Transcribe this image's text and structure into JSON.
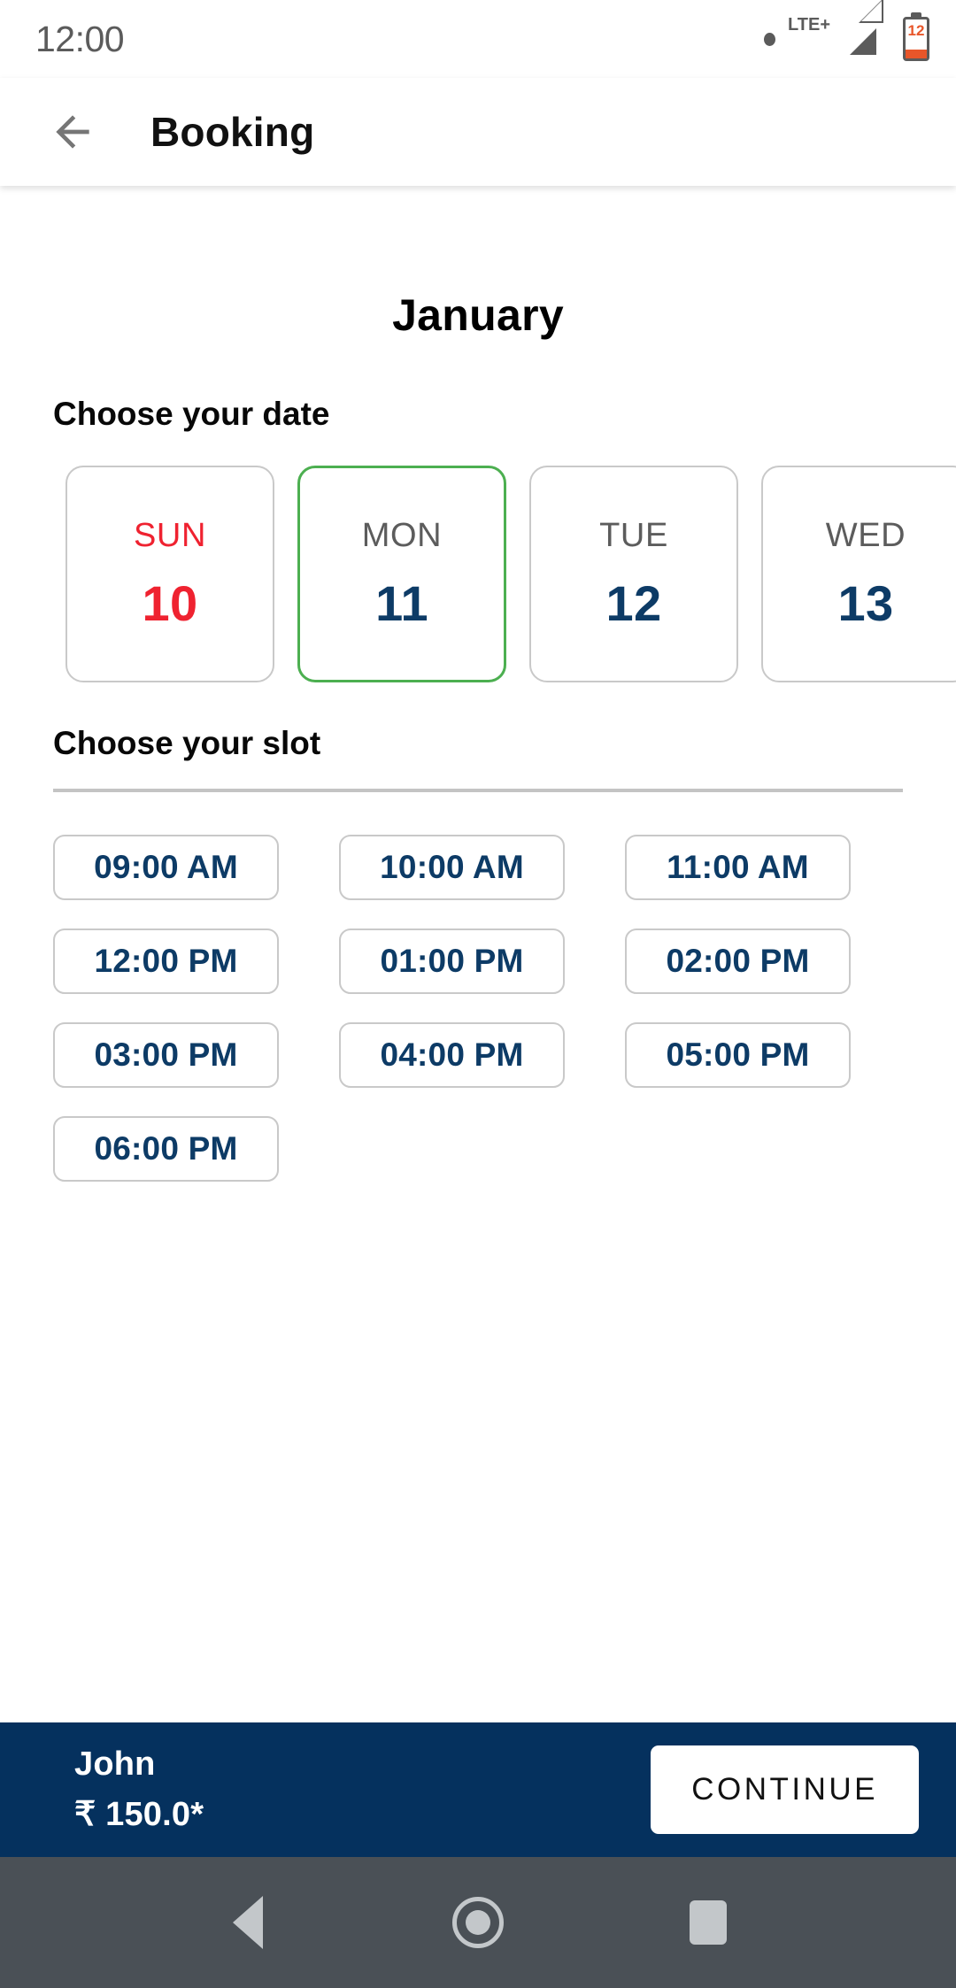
{
  "statusbar": {
    "time": "12:00",
    "network_label": "LTE+",
    "battery_percent": "12",
    "icons": {
      "dot": "notification-dot-icon",
      "signal": "signal-bars-icon",
      "battery": "battery-icon"
    }
  },
  "appbar": {
    "title": "Booking",
    "back_icon": "arrow-left-icon"
  },
  "main": {
    "month": "January",
    "date_label": "Choose your date",
    "slot_label": "Choose your slot",
    "dates": [
      {
        "dow": "SUN",
        "day": "10",
        "selected": false,
        "weekend": true
      },
      {
        "dow": "MON",
        "day": "11",
        "selected": true,
        "weekend": false
      },
      {
        "dow": "TUE",
        "day": "12",
        "selected": false,
        "weekend": false
      },
      {
        "dow": "WED",
        "day": "13",
        "selected": false,
        "weekend": false
      }
    ],
    "slots": [
      "09:00 AM",
      "10:00 AM",
      "11:00 AM",
      "12:00 PM",
      "01:00 PM",
      "02:00 PM",
      "03:00 PM",
      "04:00 PM",
      "05:00 PM",
      "06:00 PM"
    ]
  },
  "bottombar": {
    "name": "John",
    "price": "₹ 150.0*",
    "continue_label": "CONTINUE"
  },
  "navbar": {
    "back": "nav-back-icon",
    "home": "nav-home-icon",
    "recents": "nav-recents-icon"
  },
  "colors": {
    "brand_navy": "#05315e",
    "selected_green": "#4caf50",
    "weekend_red": "#ef2230",
    "text_navy": "#0d3b66",
    "border_gray": "#c9c9c9"
  }
}
